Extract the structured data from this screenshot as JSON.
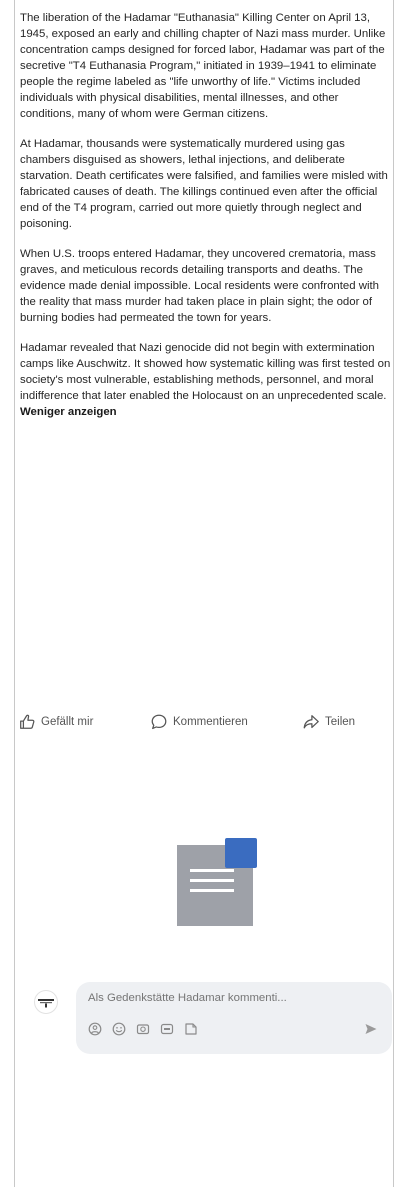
{
  "post": {
    "paragraphs": [
      "The liberation of the Hadamar \"Euthanasia\" Killing Center on April 13, 1945, exposed an early and chilling chapter of Nazi mass murder. Unlike concentration camps designed for forced labor, Hadamar was part of the secretive \"T4 Euthanasia Program,\" initiated in 1939–1941 to eliminate people the regime labeled as \"life unworthy of life.\" Victims included individuals with physical disabilities, mental illnesses, and other conditions, many of whom were German citizens.",
      "At Hadamar, thousands were systematically murdered using gas chambers disguised as showers, lethal injections, and deliberate starvation. Death certificates were falsified, and families were misled with fabricated causes of death. The killings continued even after the official end of the T4 program, carried out more quietly through neglect and poisoning.",
      "When U.S. troops entered Hadamar, they uncovered crematoria, mass graves, and meticulous records detailing transports and deaths. The evidence made denial impossible. Local residents were confronted with the reality that mass murder had taken place in plain sight; the odor of burning bodies had permeated the town for years.",
      "Hadamar revealed that Nazi genocide did not begin with extermination camps like Auschwitz. It showed how systematic killing was first tested on society's most vulnerable, establishing methods, personnel, and moral indifference that later enabled the Holocaust on an unprecedented scale."
    ],
    "show_less_label": "Weniger anzeigen"
  },
  "actions": {
    "like_label": "Gefällt mir",
    "comment_label": "Kommentieren",
    "share_label": "Teilen"
  },
  "attachment": {
    "icon": "document-icon",
    "accent_color": "#3a6cc0",
    "page_color": "#9ea1a8"
  },
  "comment": {
    "placeholder": "Als Gedenkstätte Hadamar kommenti..."
  }
}
